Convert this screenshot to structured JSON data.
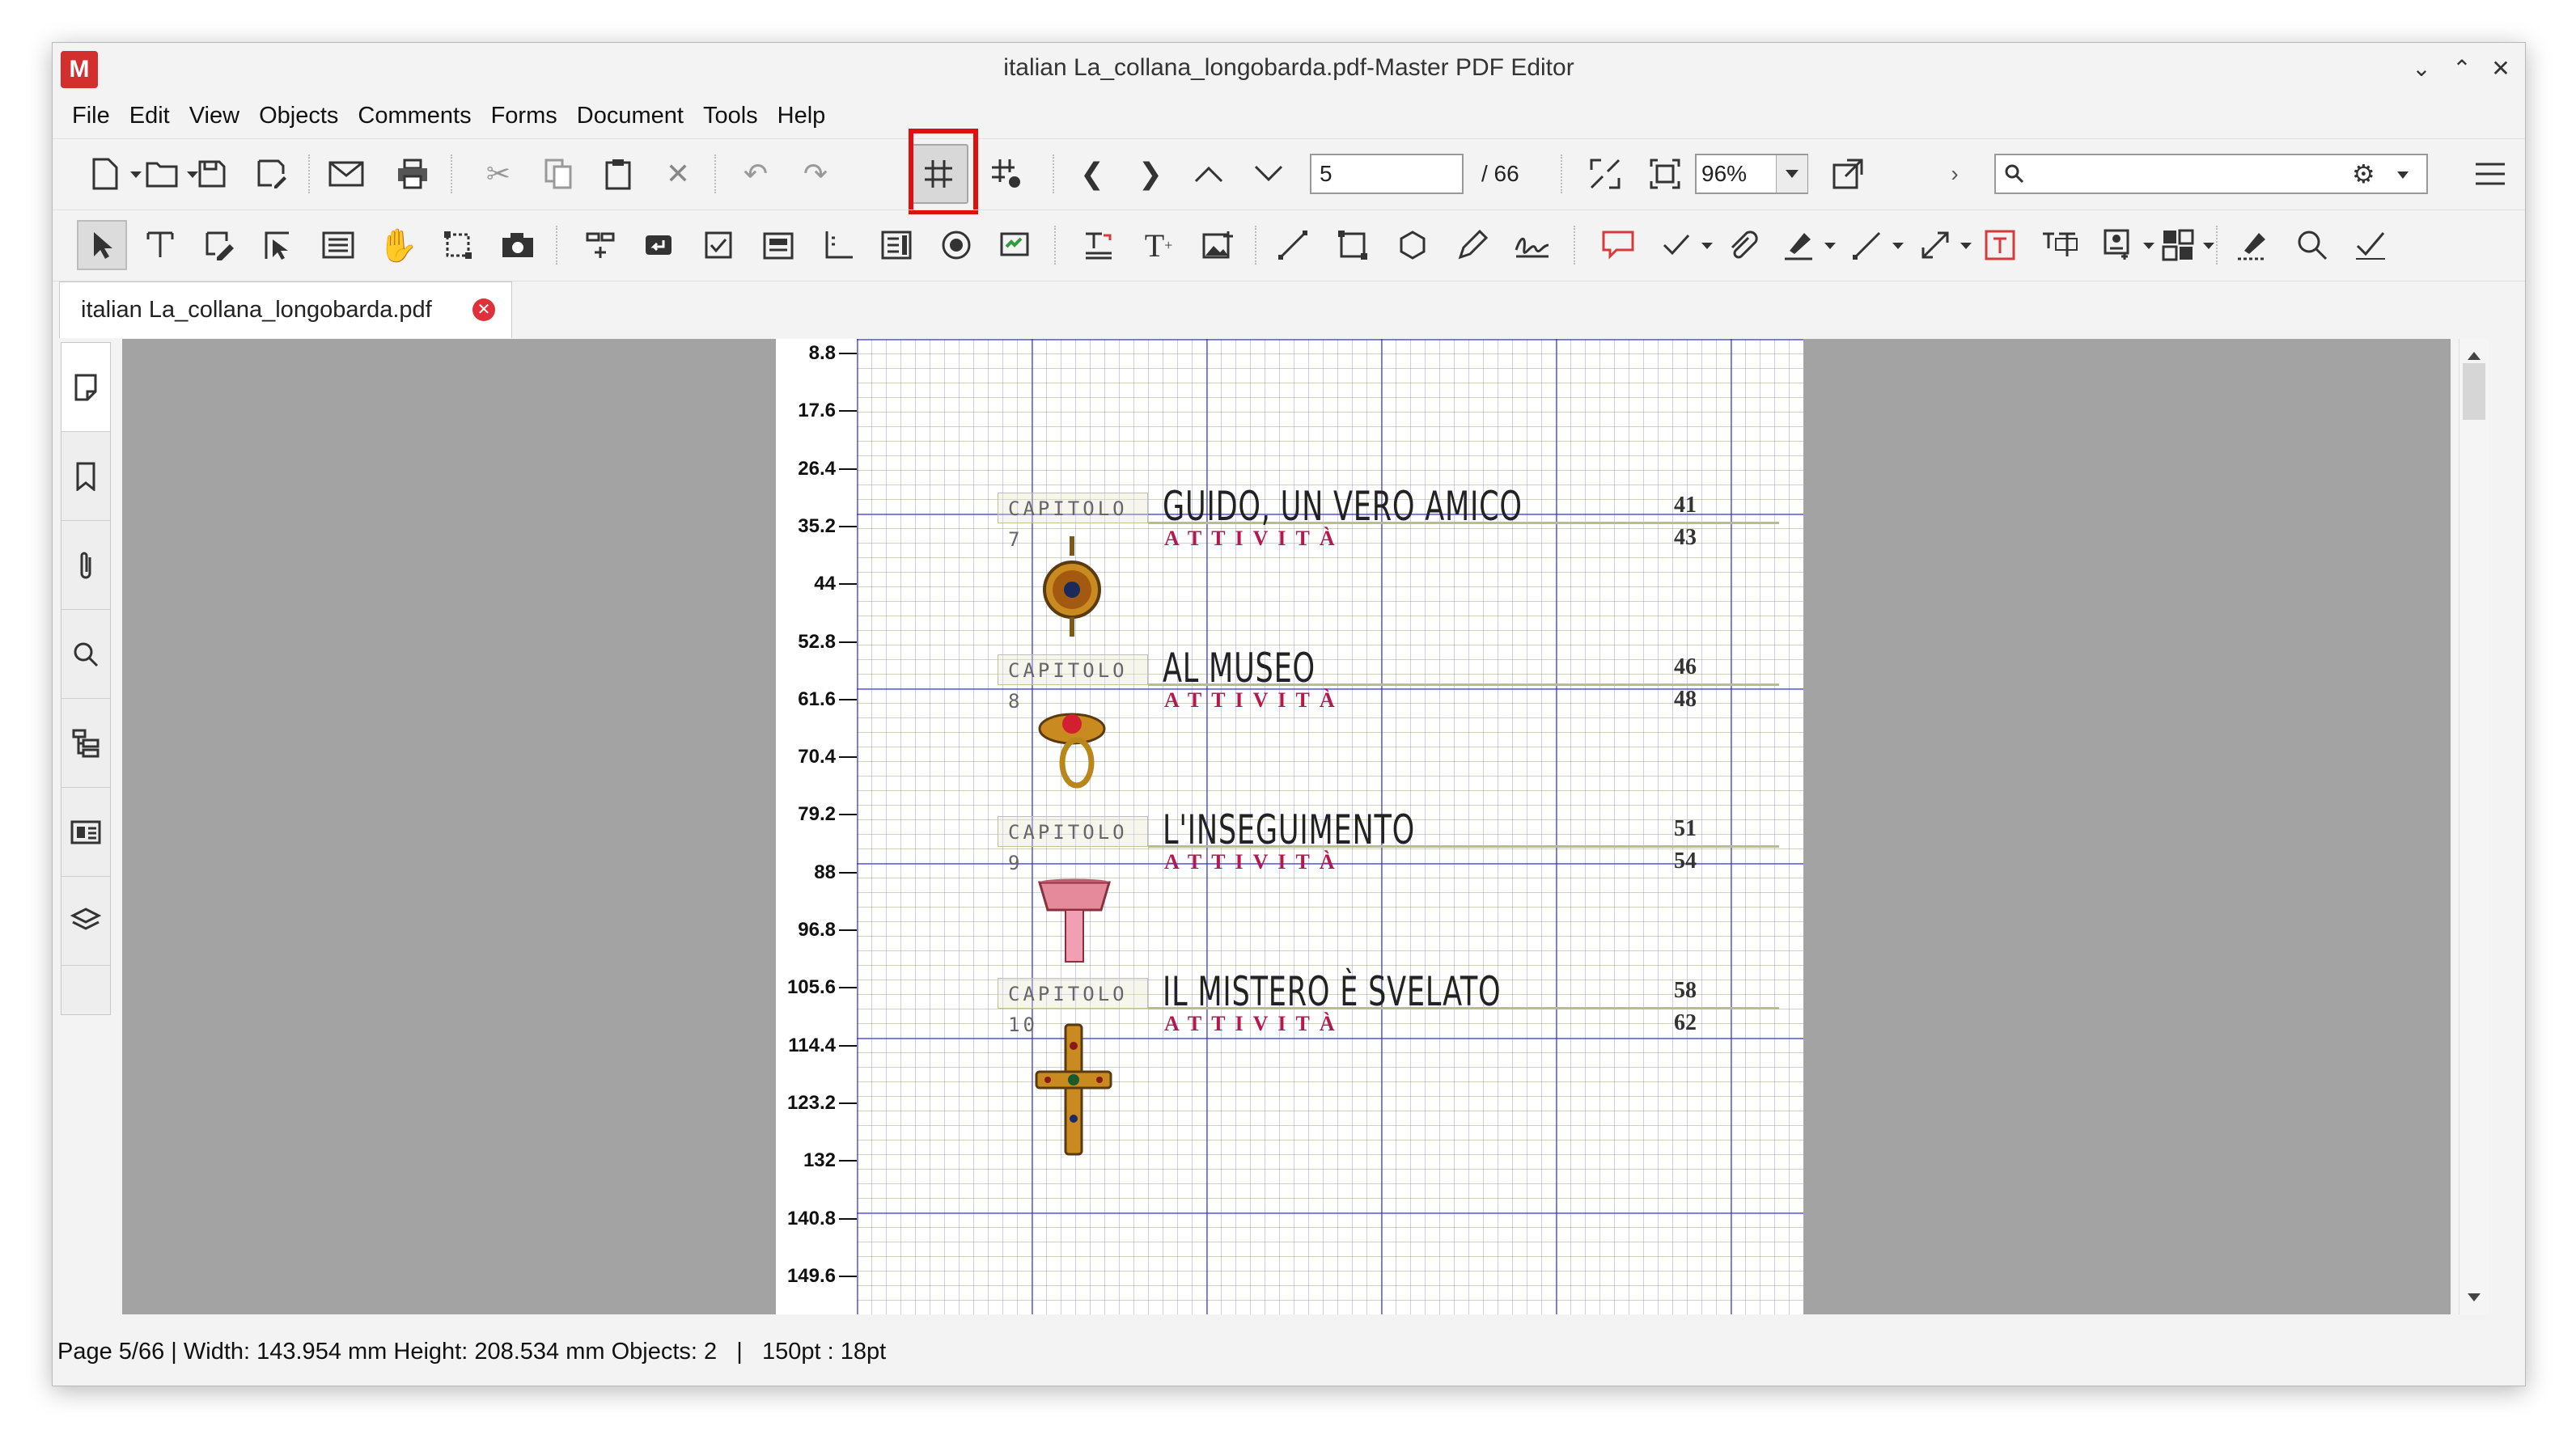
{
  "window": {
    "title": "italian La_collana_longobarda.pdf-Master PDF Editor",
    "app_logo_text": "M"
  },
  "menu": [
    "File",
    "Edit",
    "View",
    "Objects",
    "Comments",
    "Forms",
    "Document",
    "Tools",
    "Help"
  ],
  "navigation": {
    "page_value": "5",
    "page_total": "/ 66",
    "zoom_value": "96%",
    "search_placeholder": ""
  },
  "toolbar1_icons": [
    "new-document-icon",
    "open-folder-icon",
    "save-icon",
    "save-as-icon",
    "email-icon",
    "print-icon",
    "cut-icon",
    "copy-icon",
    "paste-icon",
    "delete-icon",
    "undo-icon",
    "redo-icon",
    "grid-icon",
    "snap-to-grid-icon",
    "previous-icon",
    "next-icon",
    "page-up-icon",
    "page-down-icon",
    "fit-page-icon",
    "actual-size-icon",
    "zoom-dropdown-icon",
    "fullscreen-icon",
    "search-icon",
    "settings-icon",
    "hamburger-menu-icon"
  ],
  "toolbar2_icons": [
    "select-arrow-icon",
    "edit-text-icon",
    "edit-object-icon",
    "select-region-icon",
    "form-icon",
    "hand-tool-icon",
    "crop-icon",
    "snapshot-icon",
    "link-icon",
    "button-field-icon",
    "checkbox-icon",
    "list-box-icon",
    "text-field-icon",
    "combo-box-icon",
    "radio-button-icon",
    "signature-field-icon",
    "add-text-icon",
    "typewriter-icon",
    "insert-image-icon",
    "line-icon",
    "rectangle-icon",
    "polygon-icon",
    "pencil-icon",
    "sign-icon",
    "note-icon",
    "checkmark-icon",
    "attachment-icon",
    "highlighter-icon",
    "arrow-icon",
    "measure-icon",
    "textbox-icon",
    "text-callout-icon",
    "stamp-icon",
    "pattern-icon",
    "eraser-icon",
    "search-text-icon",
    "approve-icon"
  ],
  "tab": {
    "label": "italian La_collana_longobarda.pdf"
  },
  "sidebar_icons": [
    "pages-panel-icon",
    "bookmarks-panel-icon",
    "attachments-panel-icon",
    "search-panel-icon",
    "structure-panel-icon",
    "form-fields-panel-icon",
    "layers-panel-icon"
  ],
  "ruler": {
    "labels": [
      "8.8",
      "17.6",
      "26.4",
      "35.2",
      "44",
      "52.8",
      "61.6",
      "70.4",
      "79.2",
      "88",
      "96.8",
      "105.6",
      "114.4",
      "123.2",
      "132",
      "140.8",
      "149.6"
    ]
  },
  "toc": [
    {
      "chapter": "CAPITOLO 7",
      "title": "GUIDO, UN VERO AMICO",
      "activity": "ATTIVITÀ",
      "page": "41",
      "activity_page": "43",
      "ornament": "round-brooch-icon"
    },
    {
      "chapter": "CAPITOLO 8",
      "title": "AL MUSEO",
      "activity": "ATTIVITÀ",
      "page": "46",
      "activity_page": "48",
      "ornament": "gold-ring-icon"
    },
    {
      "chapter": "CAPITOLO 9",
      "title": "L'INSEGUIMENTO",
      "activity": "ATTIVITÀ",
      "page": "51",
      "activity_page": "54",
      "ornament": "pink-goblet-icon"
    },
    {
      "chapter": "CAPITOLO 10",
      "title": "IL MISTERO È SVELATO",
      "activity": "ATTIVITÀ",
      "page": "58",
      "activity_page": "62",
      "ornament": "jeweled-cross-icon"
    }
  ],
  "status": {
    "text": "Page 5/66 | Width: 143.954 mm Height: 208.534 mm Objects: 2   |   150pt : 18pt"
  },
  "colors": {
    "highlight": "#e01010",
    "grid_major": "#2828d2",
    "activity": "#b5184c",
    "tab_close": "#e0303a"
  }
}
